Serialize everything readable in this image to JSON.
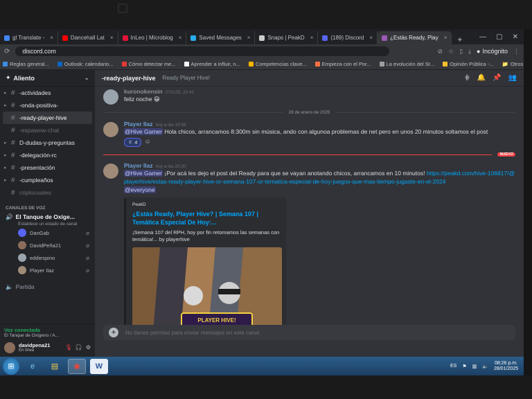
{
  "browser": {
    "tabs": [
      {
        "label": "gl Translate -",
        "color": "#4285f4"
      },
      {
        "label": "Dancehall Lat",
        "color": "#ff0000"
      },
      {
        "label": "InLeo | Microblog",
        "color": "#e31337"
      },
      {
        "label": "Saved Messages",
        "color": "#2aabee"
      },
      {
        "label": "Snaps | PeakD",
        "color": "#cccccc"
      },
      {
        "label": "(189) Discord",
        "color": "#5865f2"
      },
      {
        "label": "¿Estás Ready, Play",
        "color": "#9b59b6"
      }
    ],
    "new_tab": "+",
    "url": "discord.com",
    "profile": "Incógnito",
    "bookmarks": [
      "Reglas general...",
      "Outlook: calendario...",
      "Cómo detectar me...",
      "Aprender a influir, n...",
      "Competencias clave...",
      "Empieza con el Por...",
      "La evolución del St...",
      "Opinión Pública -..."
    ],
    "other_bookmarks": "Otros marcadores"
  },
  "discord": {
    "server_name": "Aliento",
    "channels": [
      {
        "label": "-actividades",
        "kind": "text",
        "arrow": true,
        "state": "normal"
      },
      {
        "label": "-onda-positiva-",
        "kind": "text",
        "arrow": true,
        "state": "normal"
      },
      {
        "label": "-ready-player-hive",
        "kind": "text",
        "arrow": false,
        "state": "active"
      },
      {
        "label": "-espawow-chat",
        "kind": "text",
        "arrow": false,
        "state": "muted"
      },
      {
        "label": "D-dudas-y-preguntas",
        "kind": "text",
        "arrow": true,
        "state": "normal"
      },
      {
        "label": "-delegación-rc",
        "kind": "text",
        "arrow": true,
        "state": "normal"
      },
      {
        "label": "-presentación",
        "kind": "text",
        "arrow": true,
        "state": "normal"
      },
      {
        "label": "-cumpleaños",
        "kind": "text",
        "arrow": true,
        "state": "normal"
      },
      {
        "label": "criptocuates",
        "kind": "text",
        "arrow": false,
        "state": "muted"
      }
    ],
    "voice_category": "CANALES DE VOZ",
    "voice_channel": "El Tanque de Oxíge...",
    "voice_channel_sub": "Establece un estado de canal",
    "voice_users": [
      "DanGab",
      "DavidPeña21",
      "eddiespino",
      "Player Ilaz"
    ],
    "partida": "Partida",
    "vc_status": "Voz conectada",
    "vc_sub": "El Tanque de Oxígeno / A...",
    "user": {
      "name": "davidpena21",
      "status": "En línea"
    },
    "header": {
      "channel": "-ready-player-hive",
      "topic": "Ready Player Hive!"
    },
    "messages": [
      {
        "author": "kuronokensin",
        "time": "27/1/25, 20:41",
        "text": "feliz noche 😁"
      },
      {
        "author": "Player Ilaz",
        "time": "hoy a las 19:56",
        "mention": "@Hive Gamer",
        "text": "Hola chicos, arrancamos 8:300m sin música, ando con algunoa problemas de net pero en unos 20 minutos soltamos el post",
        "reaction_emoji": "✌",
        "reaction_count": "4"
      },
      {
        "author": "Player Ilaz",
        "time": "hoy a las 20:20",
        "mention": "@Hive Gamer",
        "text": "¡Por acá les dejo el post del Ready para que se vayan anotando chicos, arrancamos en 10 minutos!",
        "link": "https://peakd.com/hive-106817/@playerhive/estas-ready-player-hive-or-semana-107-or-tematica-especial-de-hoy-juegos-que-mas-tiempo-jugaste-en-el-2024",
        "mention2": "@everyone"
      }
    ],
    "date_divider": "28 de enero de 2025",
    "new_badge": "NUEVO",
    "embed": {
      "provider": "PeakD",
      "title": "¿Estás Ready, Player Hive? | Semana 107 | Temática Especial De Hoy:...",
      "desc": "¡Semana 107 del RPH, hoy por fin retomamos las semanas con temática!... by playerhive",
      "logo": "PLAYER HIVE!"
    },
    "composer_placeholder": "No tienes permiso para enviar mensajes en este canal."
  },
  "taskbar": {
    "lang": "ES",
    "time": "08:26 p.m.",
    "date": "28/01/2025"
  }
}
